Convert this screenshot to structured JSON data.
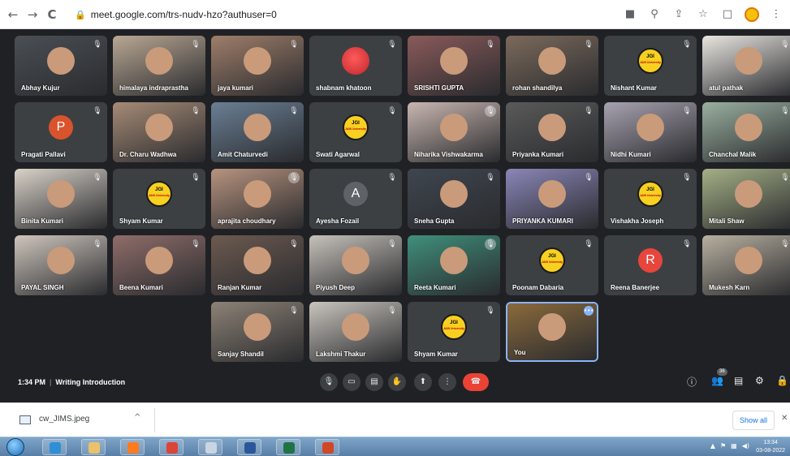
{
  "browser": {
    "url": "meet.google.com/trs-nudv-hzo?authuser=0",
    "back_icon": "←",
    "forward_icon": "→",
    "reload_icon": "C",
    "lock_icon": "🔒"
  },
  "participants": [
    {
      "name": "Abhay Kujur",
      "kind": "photo",
      "color": "#4a4f55"
    },
    {
      "name": "himalaya indraprastha",
      "kind": "photo",
      "color": "#b9a894"
    },
    {
      "name": "jaya kumari",
      "kind": "photo",
      "color": "#9e7e6a"
    },
    {
      "name": "shabnam khatoon",
      "kind": "rose",
      "color": "#c0272d"
    },
    {
      "name": "SRISHTI GUPTA",
      "kind": "photo",
      "color": "#8a5a5a"
    },
    {
      "name": "rohan shandilya",
      "kind": "photo",
      "color": "#7b6a5c"
    },
    {
      "name": "Nishant Kumar",
      "kind": "jgi",
      "color": "#f8d020"
    },
    {
      "name": "atul pathak",
      "kind": "photo",
      "color": "#e9e6e1"
    },
    {
      "name": "Pragati Pallavi",
      "kind": "letter",
      "letter": "P",
      "color": "#d9532c"
    },
    {
      "name": "Dr. Charu Wadhwa",
      "kind": "photo",
      "color": "#a68b76"
    },
    {
      "name": "Amit Chaturvedi",
      "kind": "photo",
      "color": "#6a7f94"
    },
    {
      "name": "Swati Agarwal",
      "kind": "jgi",
      "color": "#f8d020"
    },
    {
      "name": "Niharika Vishwakarma",
      "kind": "photo",
      "color": "#c8b6b0"
    },
    {
      "name": "Priyanka Kumari",
      "kind": "photo",
      "color": "#5a5a5a"
    },
    {
      "name": "Nidhi Kumari",
      "kind": "photo",
      "color": "#a8a2b0"
    },
    {
      "name": "Chanchal Malik",
      "kind": "photo",
      "color": "#9ab0a0"
    },
    {
      "name": "Binita Kumari",
      "kind": "photo",
      "color": "#d9d2c8"
    },
    {
      "name": "Shyam Kumar",
      "kind": "jgi",
      "color": "#f8d020"
    },
    {
      "name": "aprajita choudhary",
      "kind": "photo",
      "color": "#b7937f"
    },
    {
      "name": "Ayesha Fozail",
      "kind": "letter",
      "letter": "A",
      "color": "#5f6368"
    },
    {
      "name": "Sneha Gupta",
      "kind": "photo",
      "color": "#3f4650"
    },
    {
      "name": "PRIYANKA KUMARI",
      "kind": "photo",
      "color": "#8a86b8"
    },
    {
      "name": "Vishakha Joseph",
      "kind": "jgi",
      "color": "#f8d020"
    },
    {
      "name": "Mitali Shaw",
      "kind": "photo",
      "color": "#a4b086"
    },
    {
      "name": "PAYAL SINGH",
      "kind": "photo",
      "color": "#cfc6bd"
    },
    {
      "name": "Beena Kumari",
      "kind": "photo",
      "color": "#8f6d6a"
    },
    {
      "name": "Ranjan Kumar",
      "kind": "photo",
      "color": "#6c5a50"
    },
    {
      "name": "Piyush Deep",
      "kind": "photo",
      "color": "#c6c1ba"
    },
    {
      "name": "Reeta Kumari",
      "kind": "photo",
      "color": "#3f8f7c"
    },
    {
      "name": "Poonam Dabaria",
      "kind": "jgi",
      "color": "#f8d020"
    },
    {
      "name": "Reena Banerjee",
      "kind": "letter",
      "letter": "R",
      "color": "#e8453c"
    },
    {
      "name": "Mukesh Karn",
      "kind": "photo",
      "color": "#b8b0a0"
    },
    {
      "name": "Sanjay Shandil",
      "kind": "photo",
      "color": "#8d8276"
    },
    {
      "name": "Lakshmi Thakur",
      "kind": "photo",
      "color": "#c9c4bd"
    },
    {
      "name": "Shyam Kumar",
      "kind": "jgi",
      "color": "#f8d020"
    },
    {
      "name": "You",
      "kind": "self",
      "color": "#8a6a3c"
    }
  ],
  "jgi_badge": {
    "title": "JGI",
    "sub": "JAIN University"
  },
  "meeting": {
    "time": "1:34 PM",
    "separator": "|",
    "title": "Writing Introduction",
    "participant_count": "36"
  },
  "controls": {
    "mic_icon": "🎙",
    "camera_icon": "▭",
    "captions_icon": "▤",
    "raise_hand_icon": "✋",
    "present_icon": "⬆",
    "more_icon": "⋮",
    "end_call_icon": "☎",
    "info_icon": "ⓘ",
    "people_icon": "👥",
    "chat_icon": "▤",
    "activities_icon": "⚙",
    "host_icon": "🔒"
  },
  "downloads": {
    "file_name": "cw_JIMS.jpeg",
    "chevron": "^",
    "show_all": "Show all",
    "close": "✕"
  },
  "taskbar": {
    "time": "13:34",
    "date": "03-08-2022",
    "apps": [
      {
        "name": "ie",
        "color": "#2f8fd6"
      },
      {
        "name": "explorer",
        "color": "#e9c26b"
      },
      {
        "name": "firefox",
        "color": "#ff7a1f"
      },
      {
        "name": "chrome",
        "color": "#db4437"
      },
      {
        "name": "paint",
        "color": "#c9d6e2"
      },
      {
        "name": "word",
        "color": "#2b579a"
      },
      {
        "name": "excel",
        "color": "#217346"
      },
      {
        "name": "powerpoint",
        "color": "#d24726"
      }
    ]
  }
}
